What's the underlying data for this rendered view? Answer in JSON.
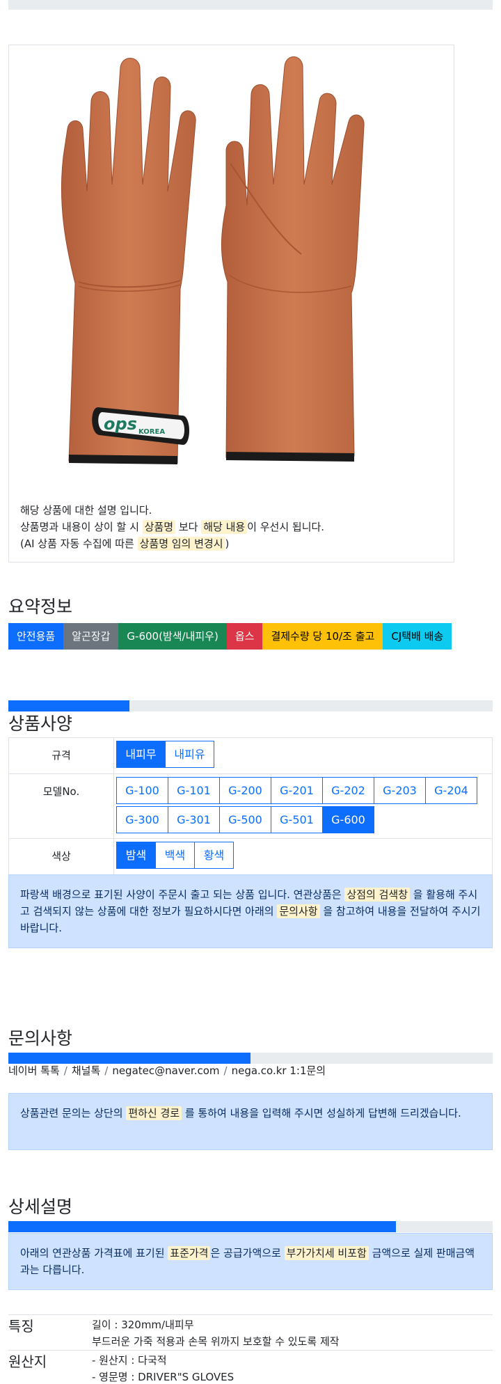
{
  "product_image": {
    "brand_logo_text": "ops KOREA",
    "description_lines": {
      "line1": "해당 상품에 대한 설명 입니다.",
      "line2_a": "상품명과 내용이 상이 할 시 ",
      "line2_mark1": "상품명",
      "line2_b": " 보다 ",
      "line2_mark2": "해당 내용",
      "line2_c": "이 우선시 됩니다.",
      "line3_a": "(AI 상품 자동 수집에 따른 ",
      "line3_mark": "상품명 임의 변경시",
      "line3_b": ")"
    }
  },
  "summary": {
    "title": "요약정보",
    "badges": [
      "안전용품",
      "알곤장갑",
      "G-600(밤색/내피우)",
      "옵스",
      "결제수량 당 10/조 출고",
      "CJ택배 배송"
    ]
  },
  "spec": {
    "title": "상품사양",
    "progress_fraction": 0.25,
    "rows": {
      "size": {
        "label": "규격",
        "options": [
          "내피무",
          "내피유"
        ],
        "selected": "내피무"
      },
      "model": {
        "label": "모델No.",
        "options_row1": [
          "G-100",
          "G-101",
          "G-200",
          "G-201",
          "G-202",
          "G-203",
          "G-204"
        ],
        "options_row2": [
          "G-300",
          "G-301",
          "G-500",
          "G-501",
          "G-600"
        ],
        "selected": "G-600"
      },
      "color": {
        "label": "색상",
        "options": [
          "밤색",
          "백색",
          "황색"
        ],
        "selected": "밤색"
      }
    },
    "notice": {
      "a": "파랑색 배경으로 표기된 사양이 주문시 출고 되는 상품 입니다. 연관상품은 ",
      "mark1": "상점의 검색창",
      "b": " 을 활용해 주시고 검색되지 않는 상품에 대한 정보가 필요하시다면 아래의 ",
      "mark2": "문의사항",
      "c": " 을 참고하여 내용을 전달하여 주시기 바랍니다."
    }
  },
  "inquiry": {
    "title": "문의사항",
    "progress_fraction": 0.5,
    "contacts": [
      "네이버 톡톡",
      "채널톡",
      "negatec@naver.com",
      "nega.co.kr 1:1문의"
    ],
    "notice": {
      "a": "상품관련 문의는 상단의 ",
      "mark": "편하신 경로",
      "b": " 를 통하여 내용을 입력해 주시면 성실하게 답변해 드리겠습니다."
    }
  },
  "detail": {
    "title": "상세설명",
    "progress_fraction": 0.8,
    "notice": {
      "a": "아래의 연관상품 가격표에 표기된 ",
      "mark1": "표준가격",
      "b": "은 공급가액으로 ",
      "mark2": "부가가치세 비포함",
      "c": " 금액으로 실제 판매금액과는 다릅니다."
    },
    "features": {
      "label": "특징",
      "line1": "길이 : 320mm/내피무",
      "line2": "부드러운 가죽 적용과 손목 위까지 보호할 수 있도록 제작"
    },
    "origin": {
      "label": "원산지",
      "line1": "- 원산지 : 다국적",
      "line2": "- 영문명 : DRIVER\"S GLOVES"
    }
  },
  "colors": {
    "primary": "#0d6efd",
    "glove": "#c8714a",
    "highlight": "#fff3cd",
    "alert_bg": "#cfe2ff"
  }
}
